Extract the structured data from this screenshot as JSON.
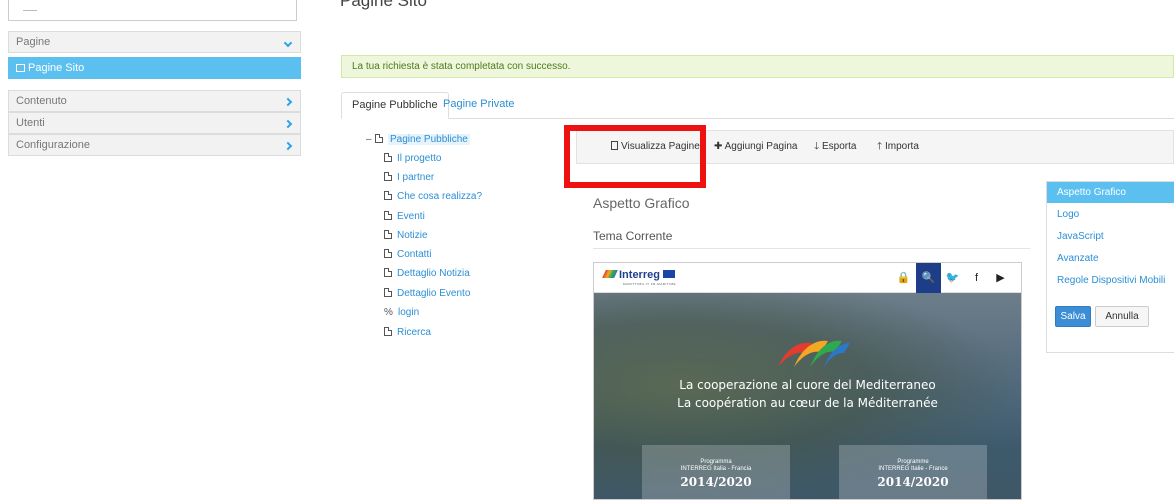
{
  "page_title": "Pagine Sito",
  "sidebar": {
    "search_placeholder": "",
    "items": [
      {
        "label": "Pagine",
        "expanded": true
      },
      {
        "label": "Pagine Sito",
        "active": true
      },
      {
        "label": "Contenuto"
      },
      {
        "label": "Utenti"
      },
      {
        "label": "Configurazione"
      }
    ]
  },
  "alert": {
    "text": "La tua richiesta è stata completata con successo."
  },
  "tabs": [
    {
      "label": "Pagine Pubbliche",
      "active": true
    },
    {
      "label": "Pagine Private"
    }
  ],
  "tree": {
    "collapse_glyph": "–",
    "root": "Pagine Pubbliche",
    "children": [
      {
        "label": "Il progetto",
        "icon": "page-icon"
      },
      {
        "label": "I partner",
        "icon": "page-icon"
      },
      {
        "label": "Che cosa realizza?",
        "icon": "page-icon"
      },
      {
        "label": "Eventi",
        "icon": "page-icon"
      },
      {
        "label": "Notizie",
        "icon": "page-icon"
      },
      {
        "label": "Contatti",
        "icon": "page-icon"
      },
      {
        "label": "Dettaglio Notizia",
        "icon": "page-icon"
      },
      {
        "label": "Dettaglio Evento",
        "icon": "page-icon"
      },
      {
        "label": "login",
        "icon": "link-icon"
      },
      {
        "label": "Ricerca",
        "icon": "page-icon"
      }
    ]
  },
  "toolbar": {
    "view_pages": "Visualizza Pagine",
    "add_page": "Aggiungi Pagina",
    "export": "Esporta",
    "import": "Importa"
  },
  "section": {
    "heading": "Aspetto Grafico",
    "subheading": "Tema Corrente"
  },
  "preview": {
    "logo": "Interreg",
    "logo_sub": "MARITTIMO-IT FR-MARITIME",
    "hero_line1": "La cooperazione al cuore del Mediterraneo",
    "hero_line2": "La coopération au cœur de la Méditerranée",
    "cards": [
      {
        "label": "Programma",
        "sub": "INTERREG Italia - Francia",
        "years": "2014/2020"
      },
      {
        "label": "Programme",
        "sub": "INTERREG Italie - France",
        "years": "2014/2020"
      }
    ]
  },
  "right_nav": {
    "items": [
      {
        "label": "Aspetto Grafico",
        "active": true
      },
      {
        "label": "Logo"
      },
      {
        "label": "JavaScript"
      },
      {
        "label": "Avanzate"
      },
      {
        "label": "Regole Dispositivi Mobili"
      }
    ],
    "save": "Salva",
    "cancel": "Annulla"
  },
  "colors": {
    "accent": "#5bc0f0",
    "link": "#2a8fd6",
    "highlight": "#ee1111",
    "alert_bg": "#eef7dc",
    "primary_button": "#3b8ed6"
  }
}
